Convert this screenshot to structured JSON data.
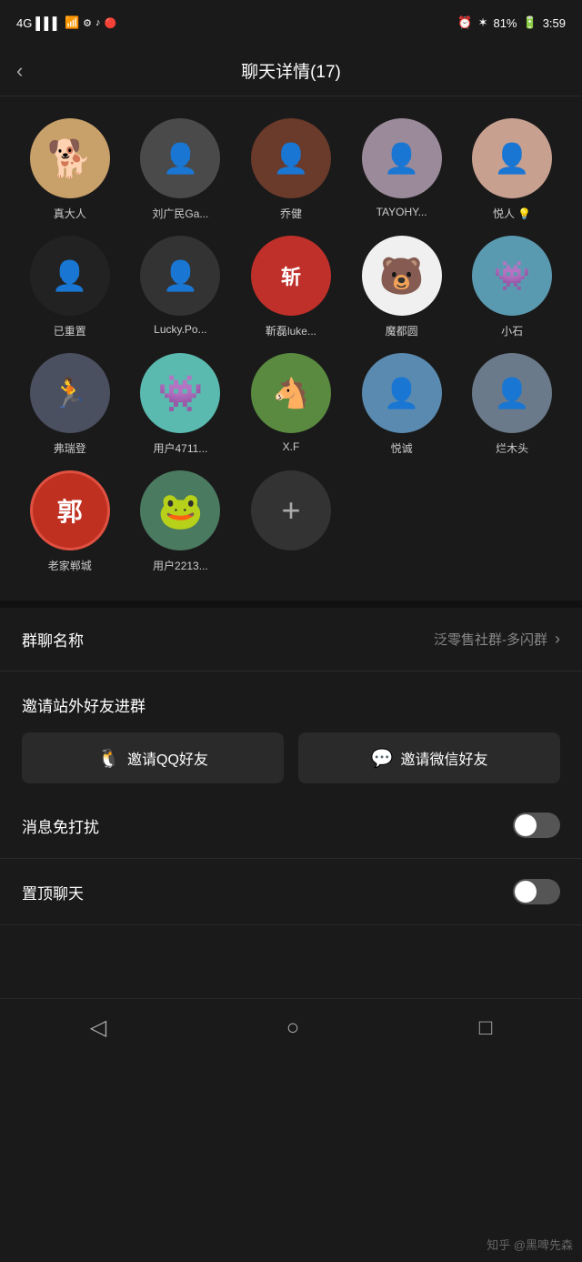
{
  "statusBar": {
    "signal": "4G",
    "time": "3:59",
    "battery": "81%"
  },
  "header": {
    "title": "聊天详情(17)",
    "backLabel": "‹"
  },
  "members": [
    {
      "name": "真大人",
      "avatarType": "emoji",
      "emoji": "🐕",
      "bg": "#c8a06a"
    },
    {
      "name": "刘广民Ga...",
      "avatarType": "color",
      "bg": "#4a4a4a",
      "emoji": "👤"
    },
    {
      "name": "乔健",
      "avatarType": "color",
      "bg": "#6a3a2a",
      "emoji": "👤"
    },
    {
      "name": "TAYOHY...",
      "avatarType": "color",
      "bg": "#9a8a9a",
      "emoji": "👤"
    },
    {
      "name": "悦人 💡",
      "avatarType": "color",
      "bg": "#c8a090",
      "emoji": "👤"
    },
    {
      "name": "已重置",
      "avatarType": "color",
      "bg": "#222",
      "emoji": "👤"
    },
    {
      "name": "Lucky.Po...",
      "avatarType": "color",
      "bg": "#333",
      "emoji": "👤"
    },
    {
      "name": "靳磊luke...",
      "avatarType": "text",
      "text": "斩",
      "bg": "#c0302a"
    },
    {
      "name": "魔都圆",
      "avatarType": "emoji",
      "emoji": "🐻",
      "bg": "#f0f0f0"
    },
    {
      "name": "小石",
      "avatarType": "color",
      "bg": "#5a9ab0",
      "emoji": "👾"
    },
    {
      "name": "弗瑞登",
      "avatarType": "color",
      "bg": "#4a5060",
      "emoji": "🏃"
    },
    {
      "name": "用户4711...",
      "avatarType": "emoji",
      "emoji": "👾",
      "bg": "#5abab0"
    },
    {
      "name": "X.F",
      "avatarType": "color",
      "bg": "#5a8a40",
      "emoji": "🐴"
    },
    {
      "name": "悦诚",
      "avatarType": "color",
      "bg": "#5a8ab0",
      "emoji": "👤"
    },
    {
      "name": "烂木头",
      "avatarType": "color",
      "bg": "#6a7a8a",
      "emoji": "👤"
    },
    {
      "name": "老家郸城",
      "avatarType": "text",
      "text": "郭",
      "bg": "#c03020"
    },
    {
      "name": "用户2213...",
      "avatarType": "emoji",
      "emoji": "🐸",
      "bg": "#4a7a60"
    }
  ],
  "settings": {
    "groupName": {
      "label": "群聊名称",
      "value": "泛零售社群-多闪群"
    },
    "inviteSection": {
      "title": "邀请站外好友进群",
      "qqBtn": "邀请QQ好友",
      "wechatBtn": "邀请微信好友"
    },
    "doNotDisturb": {
      "label": "消息免打扰",
      "enabled": false
    },
    "pinChat": {
      "label": "置顶聊天",
      "enabled": false
    }
  },
  "bottomNav": {
    "back": "◁",
    "home": "○",
    "recent": "□"
  },
  "watermark": "知乎 @黑啤先森"
}
